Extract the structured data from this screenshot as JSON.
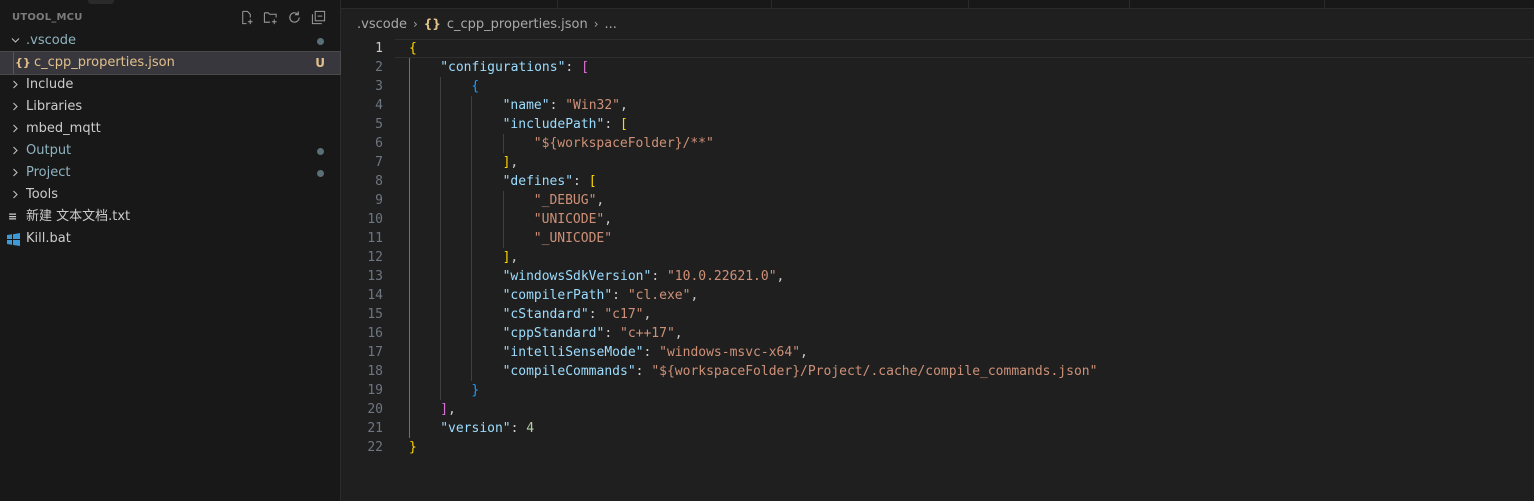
{
  "sidebar": {
    "project_title": "UTOOL_MCU",
    "actions": [
      {
        "name": "new-file-icon"
      },
      {
        "name": "new-folder-icon"
      },
      {
        "name": "refresh-icon"
      },
      {
        "name": "collapse-all-icon"
      }
    ],
    "tree": [
      {
        "label": ".vscode",
        "type": "folder",
        "expanded": true,
        "status": "dot",
        "color": "#8fb3bf"
      },
      {
        "label": "c_cpp_properties.json",
        "type": "json-file",
        "selected": true,
        "status": "U",
        "icon": "{}"
      },
      {
        "label": "Include",
        "type": "folder",
        "expanded": false
      },
      {
        "label": "Libraries",
        "type": "folder",
        "expanded": false
      },
      {
        "label": "mbed_mqtt",
        "type": "folder",
        "expanded": false
      },
      {
        "label": "Output",
        "type": "folder",
        "expanded": false,
        "status": "dot",
        "color": "#8fb3bf"
      },
      {
        "label": "Project",
        "type": "folder",
        "expanded": false,
        "status": "dot",
        "color": "#8fb3bf"
      },
      {
        "label": "Tools",
        "type": "folder",
        "expanded": false
      },
      {
        "label": "新建 文本文档.txt",
        "type": "txt-file",
        "icon": "≡"
      },
      {
        "label": "Kill.bat",
        "type": "bat-file"
      }
    ]
  },
  "editor": {
    "breadcrumb": {
      "folder": ".vscode",
      "file_icon": "{}",
      "file": "c_cpp_properties.json",
      "more": "..."
    },
    "active_line": 1,
    "lines": [
      {
        "n": "1",
        "indent": 0,
        "tokens": [
          [
            "{",
            "b1"
          ]
        ]
      },
      {
        "n": "2",
        "indent": 1,
        "tokens": [
          [
            "\"configurations\"",
            "key"
          ],
          [
            ": ",
            "punc"
          ],
          [
            "[",
            "b2"
          ]
        ]
      },
      {
        "n": "3",
        "indent": 2,
        "tokens": [
          [
            "{",
            "b3"
          ]
        ]
      },
      {
        "n": "4",
        "indent": 3,
        "tokens": [
          [
            "\"name\"",
            "key"
          ],
          [
            ": ",
            "punc"
          ],
          [
            "\"Win32\"",
            "str"
          ],
          [
            ",",
            "punc"
          ]
        ]
      },
      {
        "n": "5",
        "indent": 3,
        "tokens": [
          [
            "\"includePath\"",
            "key"
          ],
          [
            ": ",
            "punc"
          ],
          [
            "[",
            "b1"
          ]
        ]
      },
      {
        "n": "6",
        "indent": 4,
        "tokens": [
          [
            "\"${workspaceFolder}/**\"",
            "str"
          ]
        ]
      },
      {
        "n": "7",
        "indent": 3,
        "tokens": [
          [
            "]",
            "b1"
          ],
          [
            ",",
            "punc"
          ]
        ]
      },
      {
        "n": "8",
        "indent": 3,
        "tokens": [
          [
            "\"defines\"",
            "key"
          ],
          [
            ": ",
            "punc"
          ],
          [
            "[",
            "b1"
          ]
        ]
      },
      {
        "n": "9",
        "indent": 4,
        "tokens": [
          [
            "\"_DEBUG\"",
            "str"
          ],
          [
            ",",
            "punc"
          ]
        ]
      },
      {
        "n": "10",
        "indent": 4,
        "tokens": [
          [
            "\"UNICODE\"",
            "str"
          ],
          [
            ",",
            "punc"
          ]
        ]
      },
      {
        "n": "11",
        "indent": 4,
        "tokens": [
          [
            "\"_UNICODE\"",
            "str"
          ]
        ]
      },
      {
        "n": "12",
        "indent": 3,
        "tokens": [
          [
            "]",
            "b1"
          ],
          [
            ",",
            "punc"
          ]
        ]
      },
      {
        "n": "13",
        "indent": 3,
        "tokens": [
          [
            "\"windowsSdkVersion\"",
            "key"
          ],
          [
            ": ",
            "punc"
          ],
          [
            "\"10.0.22621.0\"",
            "str"
          ],
          [
            ",",
            "punc"
          ]
        ]
      },
      {
        "n": "14",
        "indent": 3,
        "tokens": [
          [
            "\"compilerPath\"",
            "key"
          ],
          [
            ": ",
            "punc"
          ],
          [
            "\"cl.exe\"",
            "str"
          ],
          [
            ",",
            "punc"
          ]
        ]
      },
      {
        "n": "15",
        "indent": 3,
        "tokens": [
          [
            "\"cStandard\"",
            "key"
          ],
          [
            ": ",
            "punc"
          ],
          [
            "\"c17\"",
            "str"
          ],
          [
            ",",
            "punc"
          ]
        ]
      },
      {
        "n": "16",
        "indent": 3,
        "tokens": [
          [
            "\"cppStandard\"",
            "key"
          ],
          [
            ": ",
            "punc"
          ],
          [
            "\"c++17\"",
            "str"
          ],
          [
            ",",
            "punc"
          ]
        ]
      },
      {
        "n": "17",
        "indent": 3,
        "tokens": [
          [
            "\"intelliSenseMode\"",
            "key"
          ],
          [
            ": ",
            "punc"
          ],
          [
            "\"windows-msvc-x64\"",
            "str"
          ],
          [
            ",",
            "punc"
          ]
        ]
      },
      {
        "n": "18",
        "indent": 3,
        "tokens": [
          [
            "\"compileCommands\"",
            "key"
          ],
          [
            ": ",
            "punc"
          ],
          [
            "\"${workspaceFolder}/Project/.cache/compile_commands.json\"",
            "str"
          ]
        ]
      },
      {
        "n": "19",
        "indent": 2,
        "tokens": [
          [
            "}",
            "b3"
          ]
        ]
      },
      {
        "n": "20",
        "indent": 1,
        "tokens": [
          [
            "]",
            "b2"
          ],
          [
            ",",
            "punc"
          ]
        ]
      },
      {
        "n": "21",
        "indent": 1,
        "tokens": [
          [
            "\"version\"",
            "key"
          ],
          [
            ": ",
            "punc"
          ],
          [
            "4",
            "num"
          ]
        ]
      },
      {
        "n": "22",
        "indent": 0,
        "tokens": [
          [
            "}",
            "b1"
          ]
        ]
      }
    ]
  },
  "colors": {
    "background": "#1f1f1f",
    "sidebar": "#181818",
    "key": "#9cdcfe",
    "string": "#ce9178",
    "number": "#b5cea8",
    "bracket_gold": "#ffd700",
    "bracket_purple": "#da70d6",
    "bracket_blue": "#179fff",
    "untracked": "#e2c08d"
  }
}
